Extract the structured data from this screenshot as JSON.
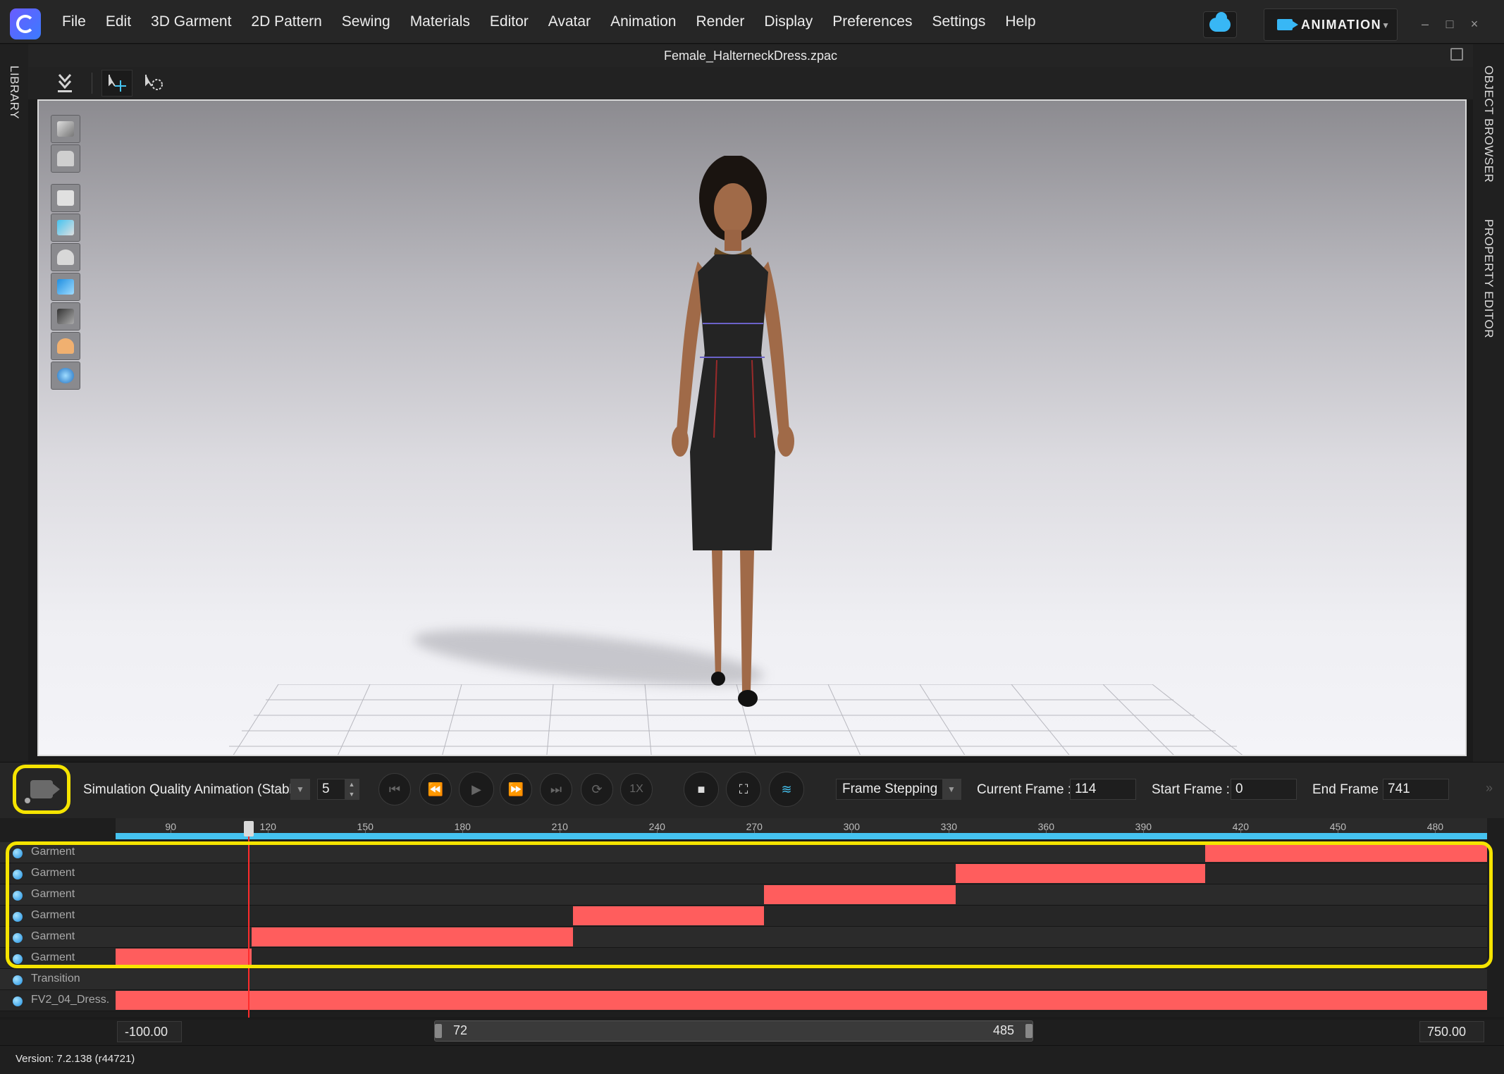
{
  "menu": {
    "items": [
      "File",
      "Edit",
      "3D Garment",
      "2D Pattern",
      "Sewing",
      "Materials",
      "Editor",
      "Avatar",
      "Animation",
      "Render",
      "Display",
      "Preferences",
      "Settings",
      "Help"
    ]
  },
  "mode": {
    "label": "ANIMATION"
  },
  "window_controls": {
    "minimize": "–",
    "maximize": "□",
    "close": "×"
  },
  "side_tabs": {
    "left": "LIBRARY",
    "right_top": "OBJECT BROWSER",
    "right_bottom": "PROPERTY EDITOR"
  },
  "file": {
    "title": "Female_HalterneckDress.zpac"
  },
  "controls": {
    "sim_quality": "Simulation Quality Animation (Stable",
    "sim_value": "5",
    "speed_label": "1X",
    "frame_mode": "Frame Stepping",
    "current_frame_label": "Current Frame :",
    "current_frame": "114",
    "start_frame_label": "Start Frame :",
    "start_frame": "0",
    "end_frame_label": "End Frame :",
    "end_frame": "741",
    "collapse_glyph": "»"
  },
  "timeline": {
    "ticks": [
      "90",
      "120",
      "150",
      "180",
      "210",
      "240",
      "270",
      "300",
      "330",
      "360",
      "390",
      "420",
      "450",
      "480"
    ],
    "playhead_frame": 114,
    "tracks": [
      {
        "name": "Garment",
        "clips": [
          [
            409,
            496
          ]
        ]
      },
      {
        "name": "Garment",
        "clips": [
          [
            332,
            409
          ]
        ]
      },
      {
        "name": "Garment",
        "clips": [
          [
            273,
            332
          ]
        ]
      },
      {
        "name": "Garment",
        "clips": [
          [
            214,
            273
          ]
        ]
      },
      {
        "name": "Garment",
        "clips": [
          [
            115,
            214
          ]
        ]
      },
      {
        "name": "Garment",
        "clips": [
          [
            73,
            115
          ]
        ]
      },
      {
        "name": "Transition",
        "clips": []
      },
      {
        "name": "FV2_04_Dress.",
        "clips": [
          [
            73,
            496
          ]
        ]
      }
    ],
    "range_min": "-100.00",
    "range_max": "750.00",
    "zoom_start": "72",
    "zoom_end": "485"
  },
  "status": {
    "version": "Version: 7.2.138 (r44721)"
  },
  "colors": {
    "accent": "#45c3f0",
    "clip": "#ff5d5d",
    "highlight": "#f5e400",
    "playhead": "#ff2b2b"
  }
}
